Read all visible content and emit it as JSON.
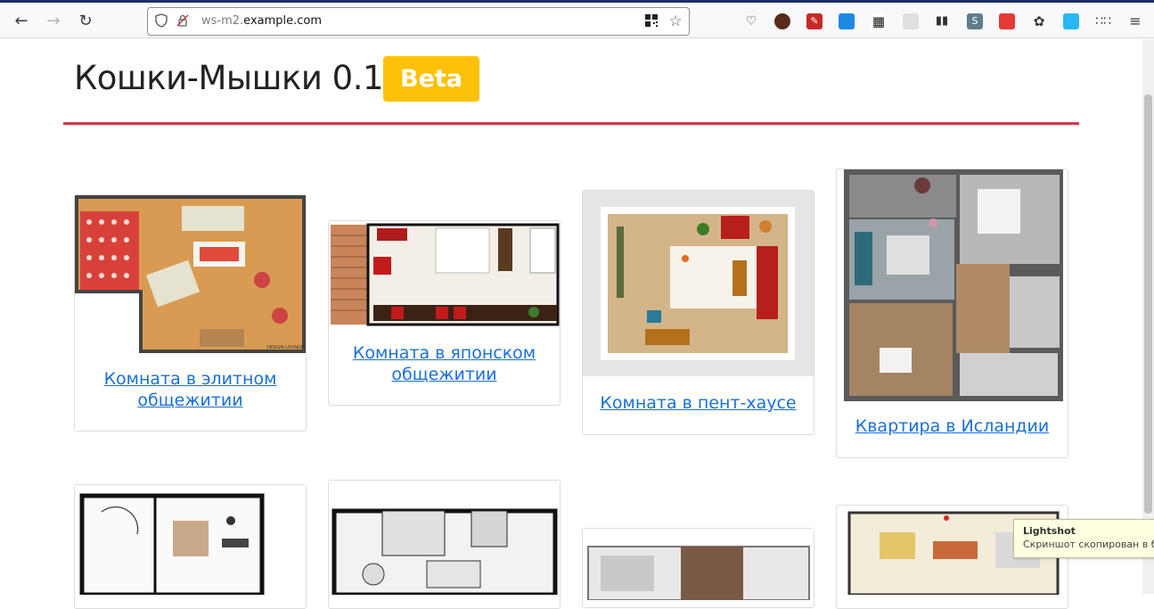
{
  "browser": {
    "url_prefix": "ws-m2.",
    "url_domain": "example.com",
    "icons": {
      "back": "arrow-left-icon",
      "forward": "arrow-right-icon",
      "reload": "reload-icon",
      "shield": "shield-icon",
      "site_permissions": "permissions-icon",
      "qr": "qr-code-icon",
      "bookmark": "star-icon",
      "pocket": "pocket-icon",
      "menu": "hamburger-menu-icon"
    }
  },
  "header": {
    "title": "Кошки-Мышки 0.1",
    "badge": "Beta",
    "badge_color": "#ffc107",
    "rule_color": "#dc3545"
  },
  "cards": [
    {
      "title": "Комната в элитном общежитии"
    },
    {
      "title": "Комната в японском общежитии"
    },
    {
      "title": "Комната в пент-хаусе"
    },
    {
      "title": "Квартира в Исландии"
    }
  ],
  "tooltip": {
    "title": "Lightshot",
    "text": "Скриншот скопирован в буфе"
  }
}
